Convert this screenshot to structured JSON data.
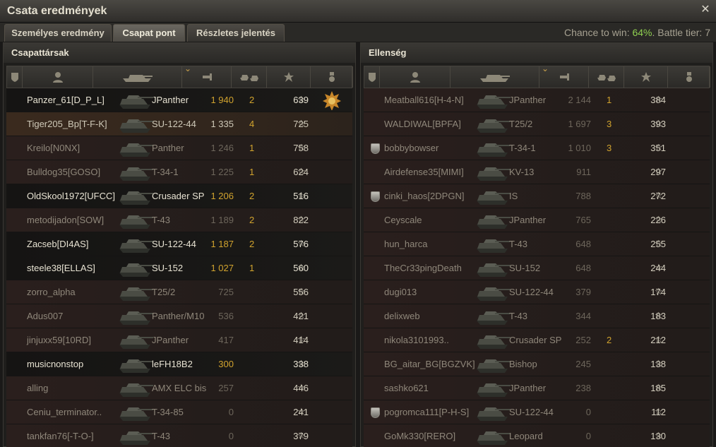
{
  "window": {
    "title": "Csata eredmények"
  },
  "tabs": [
    "Személyes eredmény",
    "Csapat pont",
    "Részletes jelentés"
  ],
  "battle_info": {
    "chance_prefix": "Chance to win: ",
    "chance_value": "64%",
    "chance_suffix": ". Battle tier: 7"
  },
  "left": {
    "title": "Csapattársak",
    "rows": [
      {
        "name": "Panzer_61[D_P_L]",
        "tank": "JPanther",
        "xp": "1 940",
        "kills": "2",
        "points": "639",
        "alive": true,
        "medal": true
      },
      {
        "name": "Tiger205_Bp[T-F-K]",
        "tank": "SU-122-44",
        "xp": "1 335",
        "kills": "4",
        "points": "725",
        "alive": true,
        "self": true
      },
      {
        "name": "Kreilo[N0NX]",
        "tank": "Panther",
        "xp": "1 246",
        "kills": "1",
        "points": "758",
        "alive": false
      },
      {
        "name": "Bulldog35[GOSO]",
        "tank": "T-34-1",
        "xp": "1 225",
        "kills": "1",
        "points": "624",
        "alive": false
      },
      {
        "name": "OldSkool1972[UFCC]",
        "tank": "Crusader SP",
        "xp": "1 206",
        "kills": "2",
        "points": "516",
        "alive": true
      },
      {
        "name": "metodijadon[SOW]",
        "tank": "T-43",
        "xp": "1 189",
        "kills": "2",
        "points": "822",
        "alive": false
      },
      {
        "name": "Zacseb[DI4AS]",
        "tank": "SU-122-44",
        "xp": "1 187",
        "kills": "2",
        "points": "576",
        "alive": true
      },
      {
        "name": "steele38[ELLAS]",
        "tank": "SU-152",
        "xp": "1 027",
        "kills": "1",
        "points": "560",
        "alive": true
      },
      {
        "name": "zorro_alpha",
        "tank": "T25/2",
        "xp": "725",
        "kills": "",
        "points": "556",
        "alive": false
      },
      {
        "name": "Adus007",
        "tank": "Panther/M10",
        "xp": "536",
        "kills": "",
        "points": "421",
        "alive": false
      },
      {
        "name": "jinjuxx59[10RD]",
        "tank": "JPanther",
        "xp": "417",
        "kills": "",
        "points": "414",
        "alive": false
      },
      {
        "name": "musicnonstop",
        "tank": "leFH18B2",
        "xp": "300",
        "kills": "",
        "points": "338",
        "alive": true
      },
      {
        "name": "alling",
        "tank": "AMX ELC bis",
        "xp": "257",
        "kills": "",
        "points": "446",
        "alive": false
      },
      {
        "name": "Ceniu_terminator..",
        "tank": "T-34-85",
        "xp": "0",
        "kills": "",
        "points": "241",
        "alive": false
      },
      {
        "name": "tankfan76[-T-O-]",
        "tank": "T-43",
        "xp": "0",
        "kills": "",
        "points": "379",
        "alive": false
      }
    ]
  },
  "right": {
    "title": "Ellenség",
    "rows": [
      {
        "name": "Meatball616[H-4-N]",
        "tank": "JPanther",
        "xp": "2 144",
        "kills": "1",
        "points": "384",
        "alive": false
      },
      {
        "name": "WALDIWAL[BPFA]",
        "tank": "T25/2",
        "xp": "1 697",
        "kills": "3",
        "points": "393",
        "alive": false
      },
      {
        "name": "bobbybowser",
        "tank": "T-34-1",
        "xp": "1 010",
        "kills": "3",
        "points": "351",
        "alive": false,
        "platoon": true
      },
      {
        "name": "Airdefense35[MIMI]",
        "tank": "KV-13",
        "xp": "911",
        "kills": "",
        "points": "297",
        "alive": false
      },
      {
        "name": "cinki_haos[2DPGN]",
        "tank": "IS",
        "xp": "788",
        "kills": "",
        "points": "272",
        "alive": false,
        "platoon": true
      },
      {
        "name": "Ceyscale",
        "tank": "JPanther",
        "xp": "765",
        "kills": "",
        "points": "226",
        "alive": false
      },
      {
        "name": "hun_harca",
        "tank": "T-43",
        "xp": "648",
        "kills": "",
        "points": "255",
        "alive": false
      },
      {
        "name": "TheCr33pingDeath",
        "tank": "SU-152",
        "xp": "648",
        "kills": "",
        "points": "244",
        "alive": false
      },
      {
        "name": "dugi013",
        "tank": "SU-122-44",
        "xp": "379",
        "kills": "",
        "points": "174",
        "alive": false
      },
      {
        "name": "delixweb",
        "tank": "T-43",
        "xp": "344",
        "kills": "",
        "points": "183",
        "alive": false
      },
      {
        "name": "nikola3101993..",
        "tank": "Crusader SP",
        "xp": "252",
        "kills": "2",
        "points": "212",
        "alive": false
      },
      {
        "name": "BG_aitar_BG[BGZVK]",
        "tank": "Bishop",
        "xp": "245",
        "kills": "",
        "points": "138",
        "alive": false
      },
      {
        "name": "sashko621",
        "tank": "JPanther",
        "xp": "238",
        "kills": "",
        "points": "185",
        "alive": false
      },
      {
        "name": "pogromca111[P-H-S]",
        "tank": "SU-122-44",
        "xp": "0",
        "kills": "",
        "points": "112",
        "alive": false,
        "platoon": true
      },
      {
        "name": "GoMk330[RERO]",
        "tank": "Leopard",
        "xp": "0",
        "kills": "",
        "points": "130",
        "alive": false
      }
    ]
  },
  "icons": {
    "header": [
      "platoon-icon",
      "player-icon",
      "vehicle-icon",
      "experience-icon",
      "kills-icon",
      "rating-icon",
      "medal-icon"
    ],
    "star": "☆"
  },
  "colors": {
    "accent": "#d1a32e",
    "chance": "#8fcf50"
  }
}
